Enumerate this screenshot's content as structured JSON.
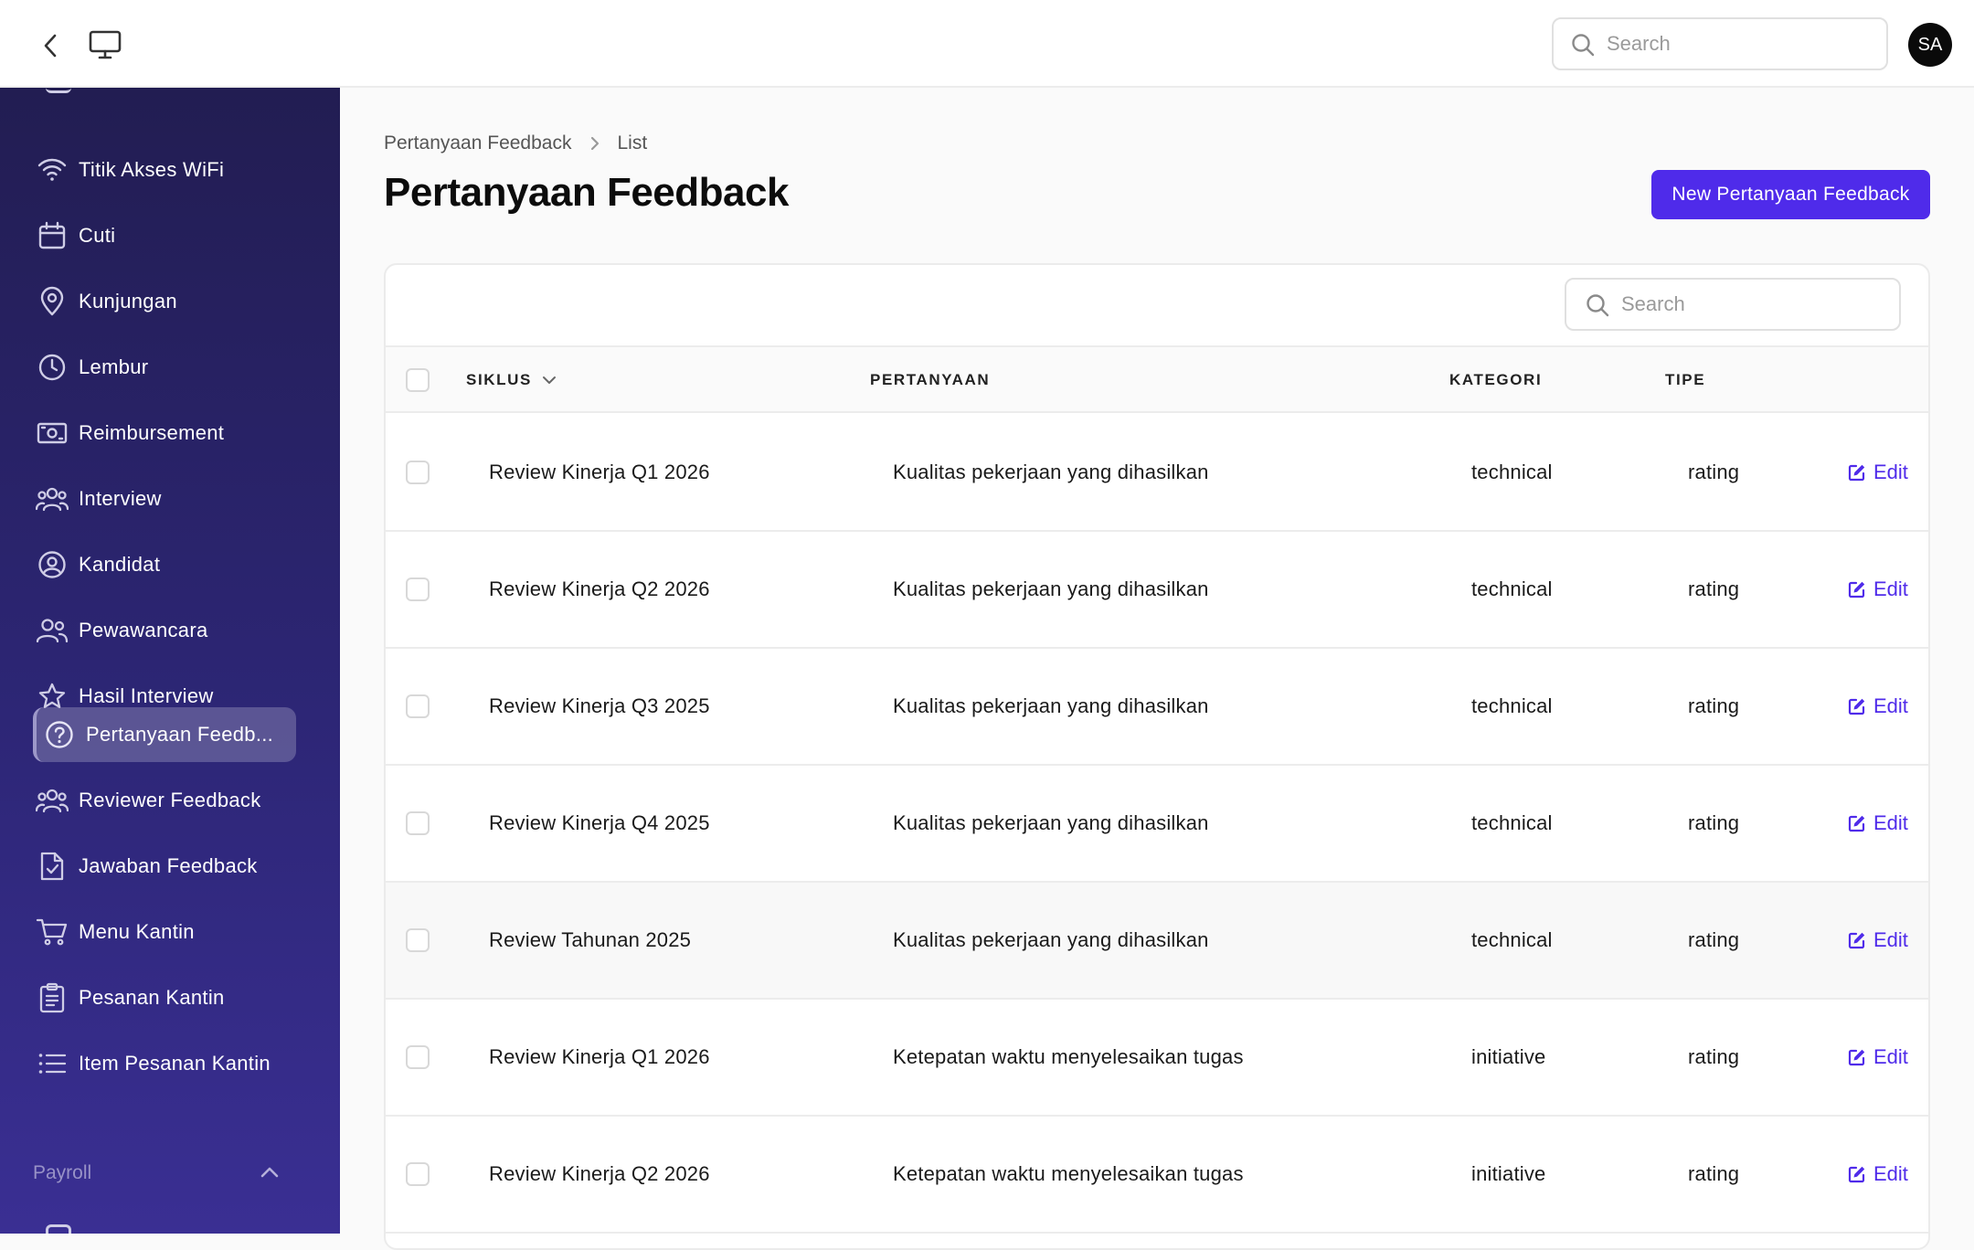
{
  "topbar": {
    "search_placeholder": "Search",
    "avatar_initials": "SA"
  },
  "sidebar": {
    "items": [
      {
        "label": "Titik Akses WiFi",
        "icon": "wifi-icon"
      },
      {
        "label": "Cuti",
        "icon": "calendar-icon"
      },
      {
        "label": "Kunjungan",
        "icon": "map-pin-icon"
      },
      {
        "label": "Lembur",
        "icon": "clock-icon"
      },
      {
        "label": "Reimbursement",
        "icon": "banknote-icon"
      },
      {
        "label": "Interview",
        "icon": "user-group-icon"
      },
      {
        "label": "Kandidat",
        "icon": "user-circle-icon"
      },
      {
        "label": "Pewawancara",
        "icon": "users-icon"
      },
      {
        "label": "Hasil Interview",
        "icon": "star-icon"
      },
      {
        "label": "Pertanyaan Feedb...",
        "icon": "question-circle-icon",
        "active": true
      },
      {
        "label": "Reviewer Feedback",
        "icon": "user-group-icon"
      },
      {
        "label": "Jawaban Feedback",
        "icon": "document-check-icon"
      },
      {
        "label": "Menu Kantin",
        "icon": "shopping-cart-icon"
      },
      {
        "label": "Pesanan Kantin",
        "icon": "clipboard-icon"
      },
      {
        "label": "Item Pesanan Kantin",
        "icon": "list-icon"
      }
    ],
    "section_payroll": "Payroll"
  },
  "breadcrumb": {
    "parent": "Pertanyaan Feedback",
    "current": "List"
  },
  "page": {
    "title": "Pertanyaan Feedback",
    "new_button": "New Pertanyaan Feedback"
  },
  "table": {
    "search_placeholder": "Search",
    "columns": {
      "siklus": "SIKLUS",
      "pertanyaan": "PERTANYAAN",
      "kategori": "KATEGORI",
      "tipe": "TIPE"
    },
    "edit_label": "Edit",
    "rows": [
      {
        "siklus": "Review Kinerja Q1 2026",
        "pertanyaan": "Kualitas pekerjaan yang dihasilkan",
        "kategori": "technical",
        "tipe": "rating"
      },
      {
        "siklus": "Review Kinerja Q2 2026",
        "pertanyaan": "Kualitas pekerjaan yang dihasilkan",
        "kategori": "technical",
        "tipe": "rating"
      },
      {
        "siklus": "Review Kinerja Q3 2025",
        "pertanyaan": "Kualitas pekerjaan yang dihasilkan",
        "kategori": "technical",
        "tipe": "rating"
      },
      {
        "siklus": "Review Kinerja Q4 2025",
        "pertanyaan": "Kualitas pekerjaan yang dihasilkan",
        "kategori": "technical",
        "tipe": "rating"
      },
      {
        "siklus": "Review Tahunan 2025",
        "pertanyaan": "Kualitas pekerjaan yang dihasilkan",
        "kategori": "technical",
        "tipe": "rating"
      },
      {
        "siklus": "Review Kinerja Q1 2026",
        "pertanyaan": "Ketepatan waktu menyelesaikan tugas",
        "kategori": "initiative",
        "tipe": "rating"
      },
      {
        "siklus": "Review Kinerja Q2 2026",
        "pertanyaan": "Ketepatan waktu menyelesaikan tugas",
        "kategori": "initiative",
        "tipe": "rating"
      }
    ]
  },
  "colors": {
    "accent": "#4f2bea",
    "sidebar_top": "#221d52",
    "sidebar_bottom": "#3a2f93"
  }
}
